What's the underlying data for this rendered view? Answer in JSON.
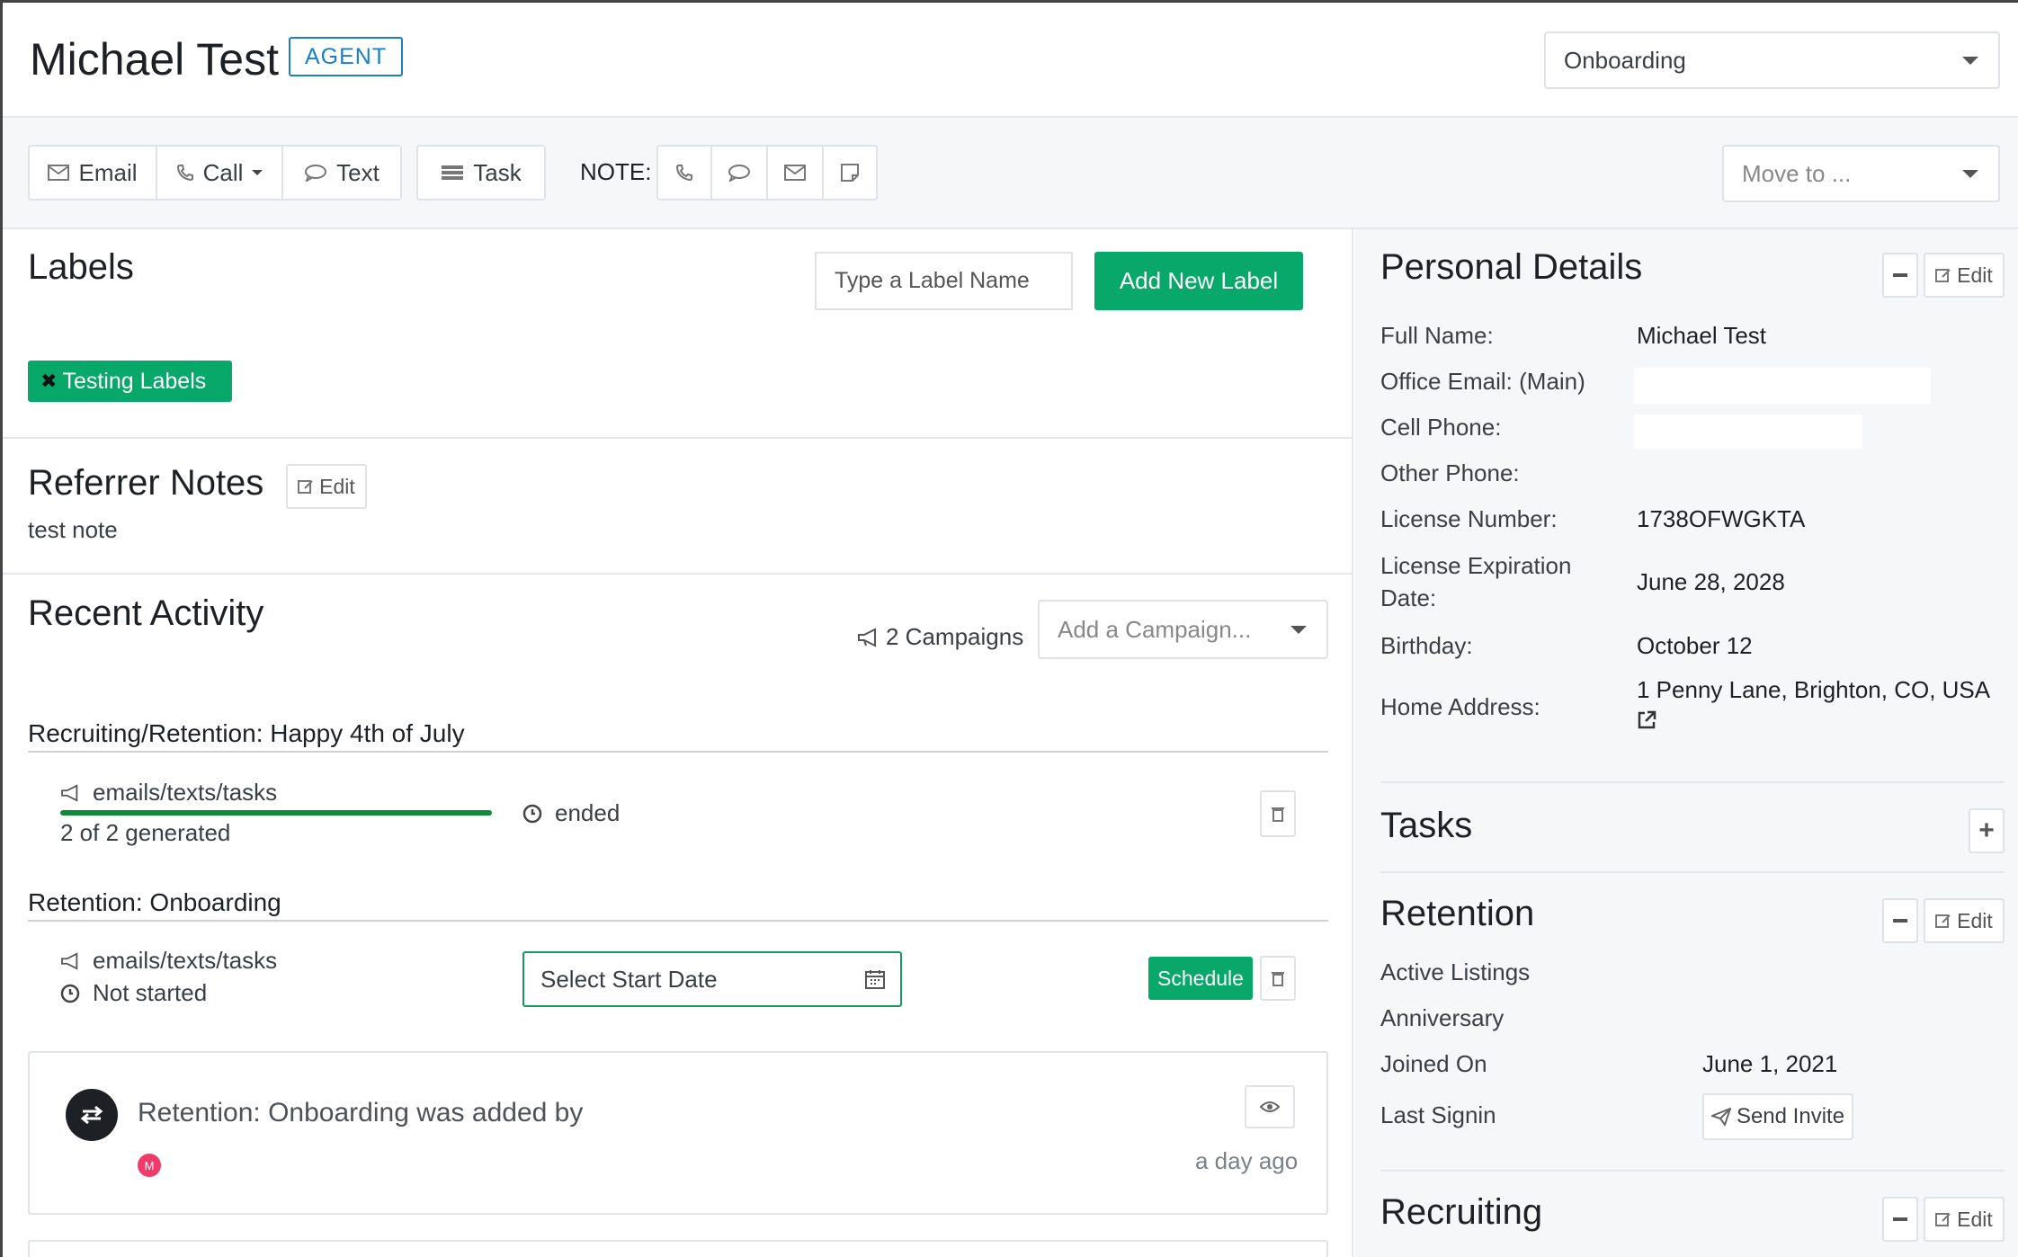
{
  "header": {
    "name": "Michael Test",
    "badge": "AGENT",
    "stage_select": "Onboarding"
  },
  "toolbar": {
    "email": "Email",
    "call": "Call",
    "text": "Text",
    "task": "Task",
    "note_label": "NOTE:",
    "move_to": "Move to ..."
  },
  "labels": {
    "title": "Labels",
    "input_placeholder": "Type a Label Name",
    "add_button": "Add New Label",
    "tags": [
      "Testing Labels"
    ]
  },
  "referrer": {
    "title": "Referrer Notes",
    "edit": "Edit",
    "note": "test note"
  },
  "activity": {
    "title": "Recent Activity",
    "campaigns_count": "2 Campaigns",
    "add_campaign_placeholder": "Add a Campaign...",
    "campaigns": [
      {
        "name": "Recruiting/Retention: Happy 4th of July",
        "type": "emails/texts/tasks",
        "generated": "2 of 2 generated",
        "status": "ended",
        "progress": 1.0
      },
      {
        "name": "Retention: Onboarding",
        "type": "emails/texts/tasks",
        "status": "Not started",
        "date_placeholder": "Select Start Date",
        "schedule": "Schedule"
      }
    ],
    "event": {
      "text": "Retention: Onboarding was added by",
      "avatar_letter": "M",
      "time": "a day ago"
    }
  },
  "personal": {
    "title": "Personal Details",
    "edit": "Edit",
    "fields": {
      "full_name_label": "Full Name:",
      "full_name": "Michael Test",
      "office_email_label": "Office Email: (Main)",
      "cell_label": "Cell Phone:",
      "other_label": "Other Phone:",
      "license_label": "License Number:",
      "license": "1738OFWGKTA",
      "license_exp_label_1": "License Expiration",
      "license_exp_label_2": "Date:",
      "license_exp": "June 28, 2028",
      "birthday_label": "Birthday:",
      "birthday": "October 12",
      "address_label": "Home Address:",
      "address": "1 Penny Lane, Brighton, CO, USA"
    }
  },
  "tasks": {
    "title": "Tasks"
  },
  "retention": {
    "title": "Retention",
    "edit": "Edit",
    "active_listings_label": "Active Listings",
    "anniversary_label": "Anniversary",
    "joined_label": "Joined On",
    "joined": "June 1, 2021",
    "last_signin_label": "Last Signin",
    "send_invite": "Send Invite"
  },
  "recruiting": {
    "title": "Recruiting",
    "edit": "Edit"
  },
  "colors": {
    "green": "#08a76a",
    "blue": "#1a7fc7"
  }
}
